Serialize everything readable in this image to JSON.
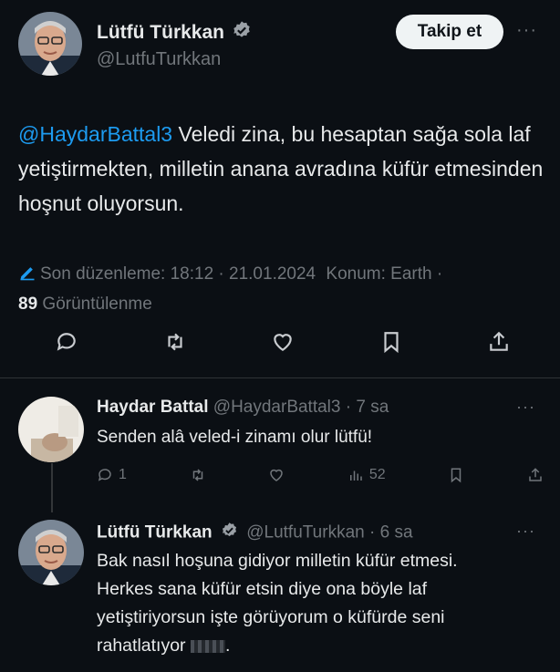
{
  "main_tweet": {
    "author_name": "Lütfü Türkkan",
    "author_handle": "@LutfuTurkkan",
    "follow_label": "Takip et",
    "more_label": "···",
    "mention": "@HaydarBattal3",
    "text": " Veledi zina, bu hesaptan sağa sola laf yetiştirmekten, milletin anana avradına küfür etmesinden hoşnut oluyorsun.",
    "edited_label": "Son düzenleme: 18:12 · 21.01.2024",
    "location_label": "Konum: Earth ·",
    "view_count": "89",
    "views_label": "Görüntülenme",
    "icons": [
      "comment-icon",
      "retweet-icon",
      "like-icon",
      "bookmark-icon",
      "share-icon"
    ]
  },
  "reply1": {
    "author_name": "Haydar Battal",
    "author_handle": "@HaydarBattal3",
    "time": "· 7 sa",
    "text": "Senden alâ veled-i zinamı olur lütfü!",
    "more_label": "···",
    "reply_count": "1",
    "view_count": "52"
  },
  "reply2": {
    "author_name": "Lütfü Türkkan",
    "author_handle": "@LutfuTurkkan",
    "time": "· 6 sa",
    "text": "Bak nasıl hoşuna gidiyor milletin küfür etmesi. Herkes sana küfür etsin diye ona böyle laf yetiştiriyorsun işte görüyorum o küfürde seni rahatlatıyor",
    "more_label": "···"
  },
  "colors": {
    "background": "#0b0f14",
    "accent": "#1d9bf0",
    "muted": "#71767b"
  }
}
